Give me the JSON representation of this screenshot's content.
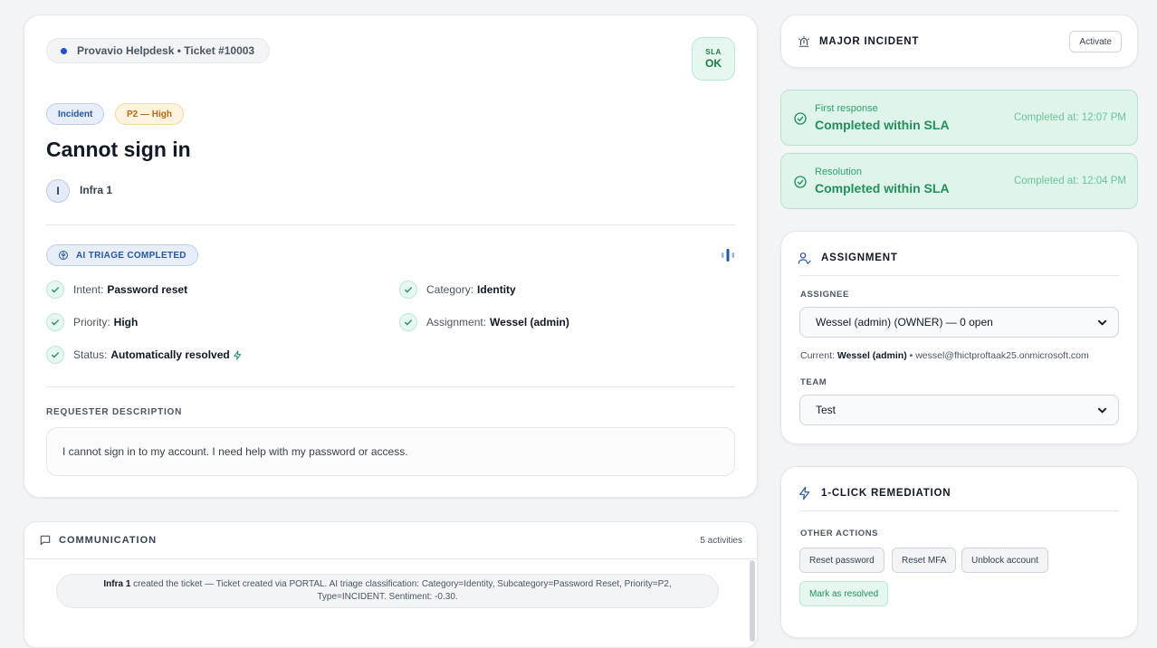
{
  "ticket": {
    "source_label": "Provavio Helpdesk • Ticket #10003",
    "sla_top": "SLA",
    "sla_status": "OK",
    "type_badge": "Incident",
    "priority_badge": "P2 — High",
    "title": "Cannot sign in",
    "requester_initial": "I",
    "requester_name": "Infra 1"
  },
  "triage": {
    "chip_label": "AI TRIAGE COMPLETED",
    "intent_label": "Intent:",
    "intent_value": "Password reset",
    "category_label": "Category:",
    "category_value": "Identity",
    "priority_label": "Priority:",
    "priority_value": "High",
    "assignment_label": "Assignment:",
    "assignment_value": "Wessel (admin)",
    "status_label": "Status:",
    "status_value": "Automatically resolved"
  },
  "description": {
    "label": "REQUESTER DESCRIPTION",
    "text": "I cannot sign in to my account. I need help with my password or access."
  },
  "communication": {
    "title": "COMMUNICATION",
    "count": "5 activities",
    "activity_actor": "Infra 1",
    "activity_text": "created the ticket — Ticket created via PORTAL. AI triage classification: Category=Identity, Subcategory=Password Reset, Priority=P2, Type=INCIDENT. Sentiment: -0.30."
  },
  "major_incident": {
    "title": "MAJOR INCIDENT",
    "activate_label": "Activate"
  },
  "sla": {
    "first_response": {
      "label": "First response",
      "value": "Completed within SLA",
      "time": "Completed at: 12:07 PM"
    },
    "resolution": {
      "label": "Resolution",
      "value": "Completed within SLA",
      "time": "Completed at: 12:04 PM"
    }
  },
  "assignment": {
    "title": "ASSIGNMENT",
    "assignee_label": "ASSIGNEE",
    "assignee_value": "Wessel (admin) (OWNER) — 0 open",
    "current_prefix": "Current:",
    "current_name": "Wessel (admin)",
    "current_email": "• wessel@fhictproftaak25.onmicrosoft.com",
    "team_label": "TEAM",
    "team_value": "Test"
  },
  "remediation": {
    "title": "1-CLICK REMEDIATION",
    "other_label": "OTHER ACTIONS",
    "actions": [
      "Reset password",
      "Reset MFA",
      "Unblock account"
    ],
    "resolve_label": "Mark as resolved"
  },
  "colors": {
    "accent_blue": "#2557a7",
    "success_green": "#21915a",
    "priority_orange": "#c2680a"
  }
}
